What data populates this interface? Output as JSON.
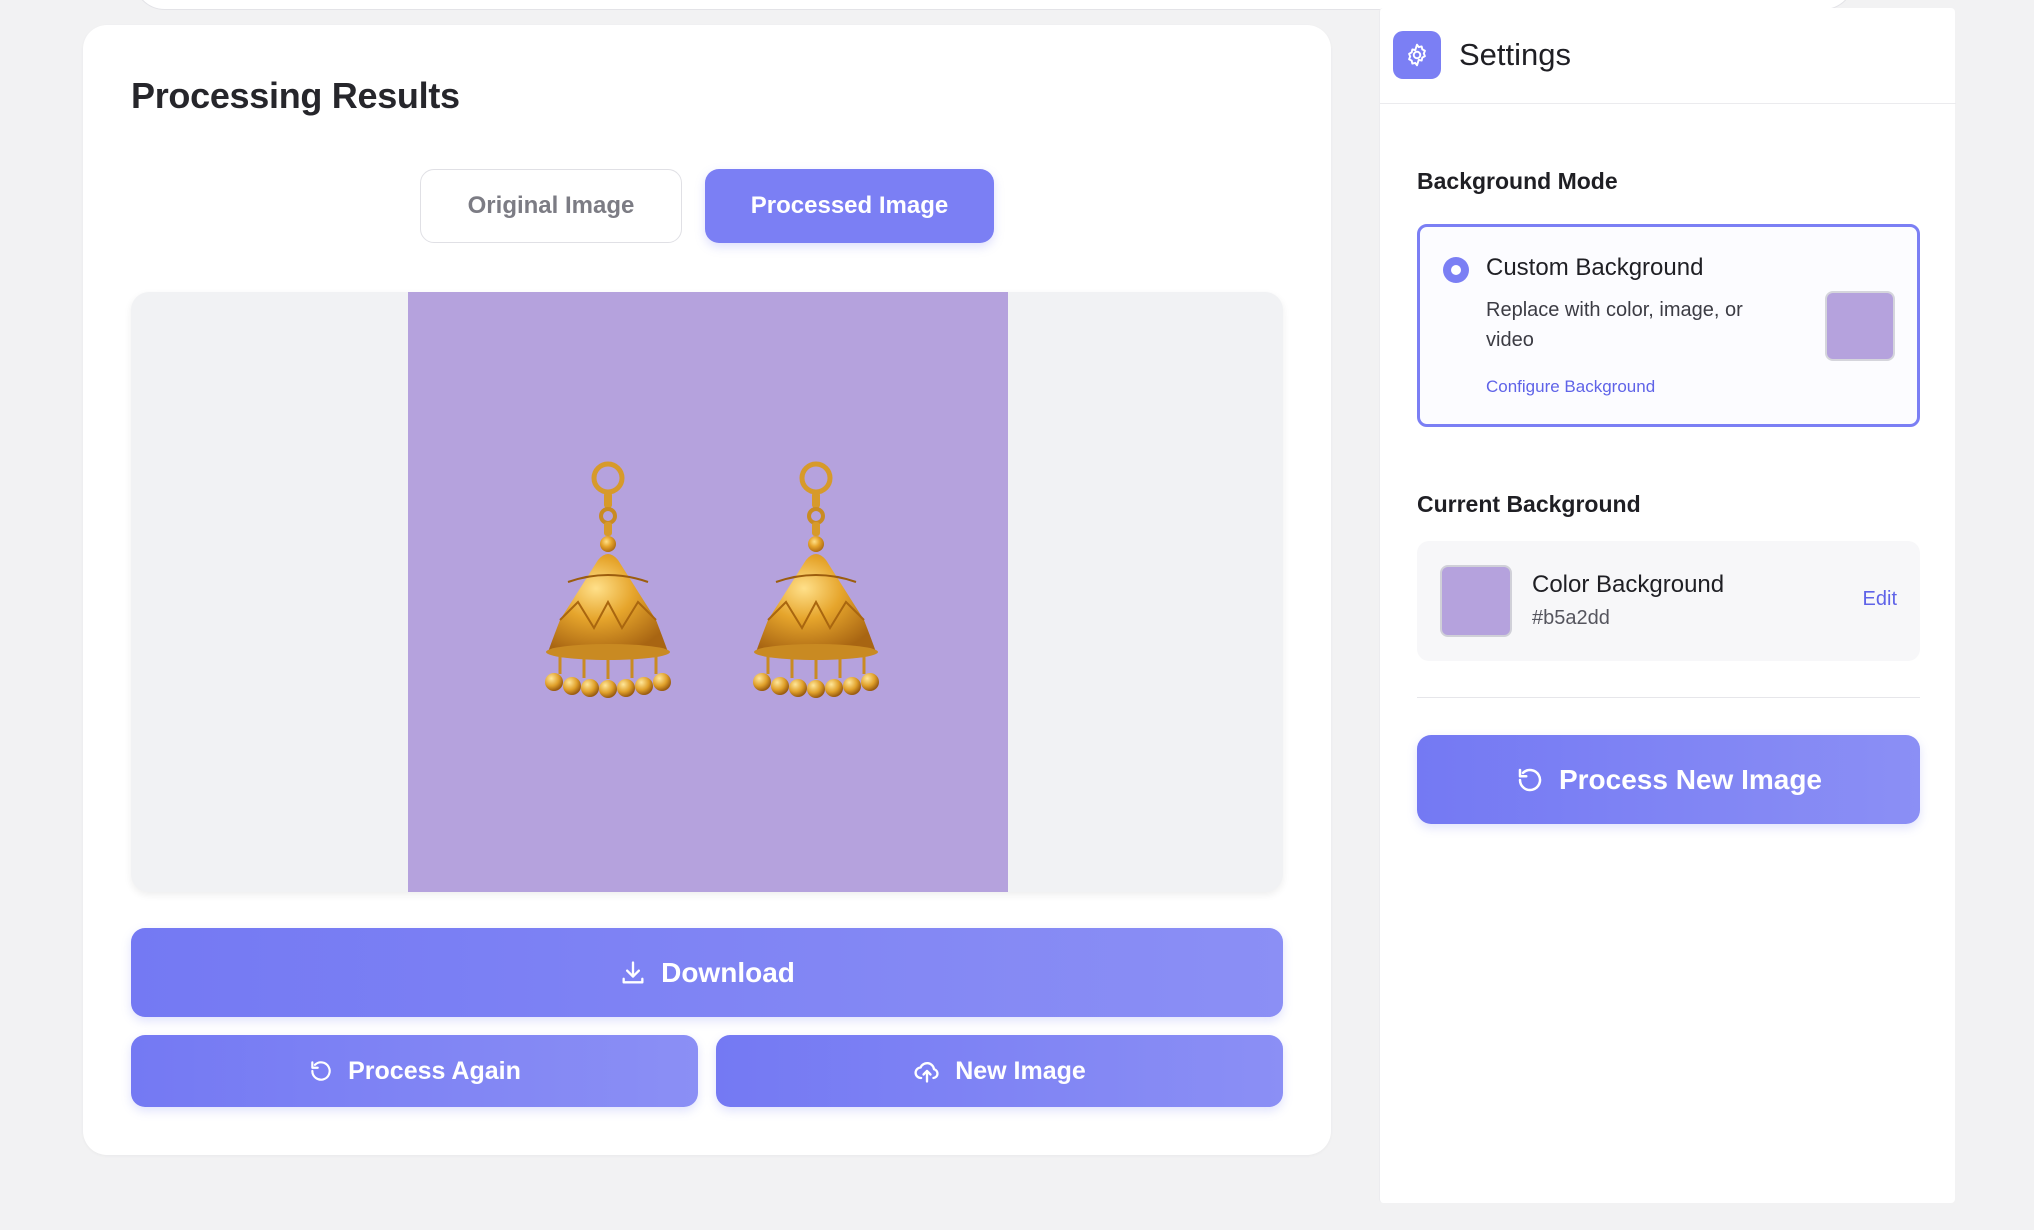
{
  "results": {
    "title": "Processing Results",
    "tabs": {
      "original": "Original Image",
      "processed": "Processed Image",
      "active": "processed"
    },
    "preview": {
      "background_color": "#b5a2dd",
      "subject": "gold jhumka earrings"
    },
    "actions": {
      "download": "Download",
      "process_again": "Process Again",
      "new_image": "New Image"
    }
  },
  "settings": {
    "title": "Settings",
    "background_mode": {
      "label": "Background Mode",
      "selected_option": {
        "title": "Custom Background",
        "description": "Replace with color, image, or video",
        "link": "Configure Background",
        "swatch_color": "#b5a2dd"
      }
    },
    "current_background": {
      "label": "Current Background",
      "name": "Color Background",
      "hex": "#b5a2dd",
      "edit": "Edit"
    },
    "process_new_button": "Process New Image"
  },
  "colors": {
    "accent": "#7b7ff4",
    "accent_light": "#8b8ff5",
    "link": "#5f63e8",
    "background_swatch": "#b5a2dd"
  }
}
